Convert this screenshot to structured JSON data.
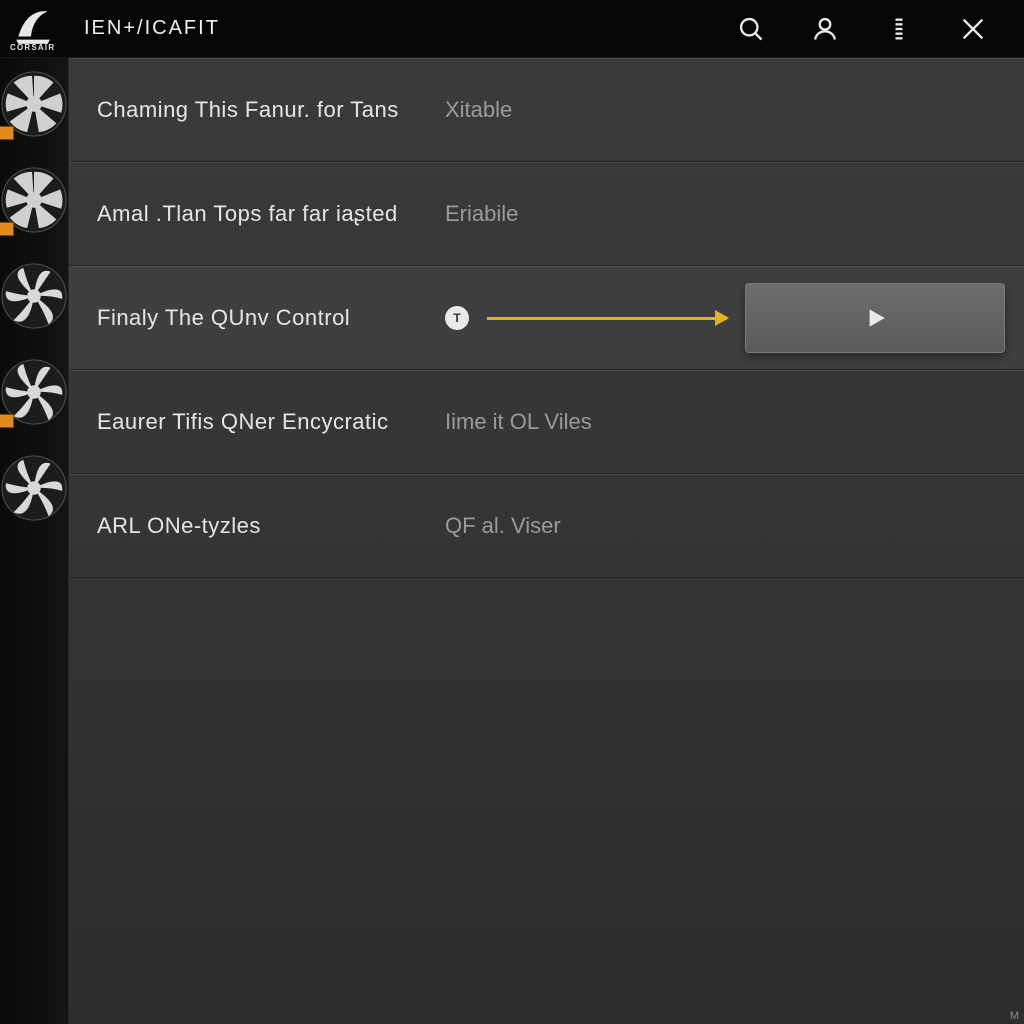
{
  "header": {
    "brand": "CORSAIR",
    "title": "IEN+/ICAFIT"
  },
  "sidebar": {
    "items": [
      {
        "id": "fan1",
        "badge": true
      },
      {
        "id": "fan2",
        "badge": true
      },
      {
        "id": "fan3",
        "badge": false
      },
      {
        "id": "fan4",
        "badge": true
      },
      {
        "id": "fan5",
        "badge": false
      }
    ]
  },
  "rows": [
    {
      "label": "Chaming  This  Fanur.  for  Tans",
      "value": "Xitable"
    },
    {
      "label": "Amal  .Tlan  Tops  far  far  iaʂted",
      "value": "Eriabile"
    },
    {
      "label": "Finaly  The  QUnv  Control",
      "value": "",
      "info_letter": "T"
    },
    {
      "label": "Eaurer  Tifis  QNer  Encycratic",
      "value": "Iime  it  OL  Viles"
    },
    {
      "label": "ARL  ONe-tyzles",
      "value": "QF  al.  Viser"
    }
  ],
  "watermark": "M"
}
